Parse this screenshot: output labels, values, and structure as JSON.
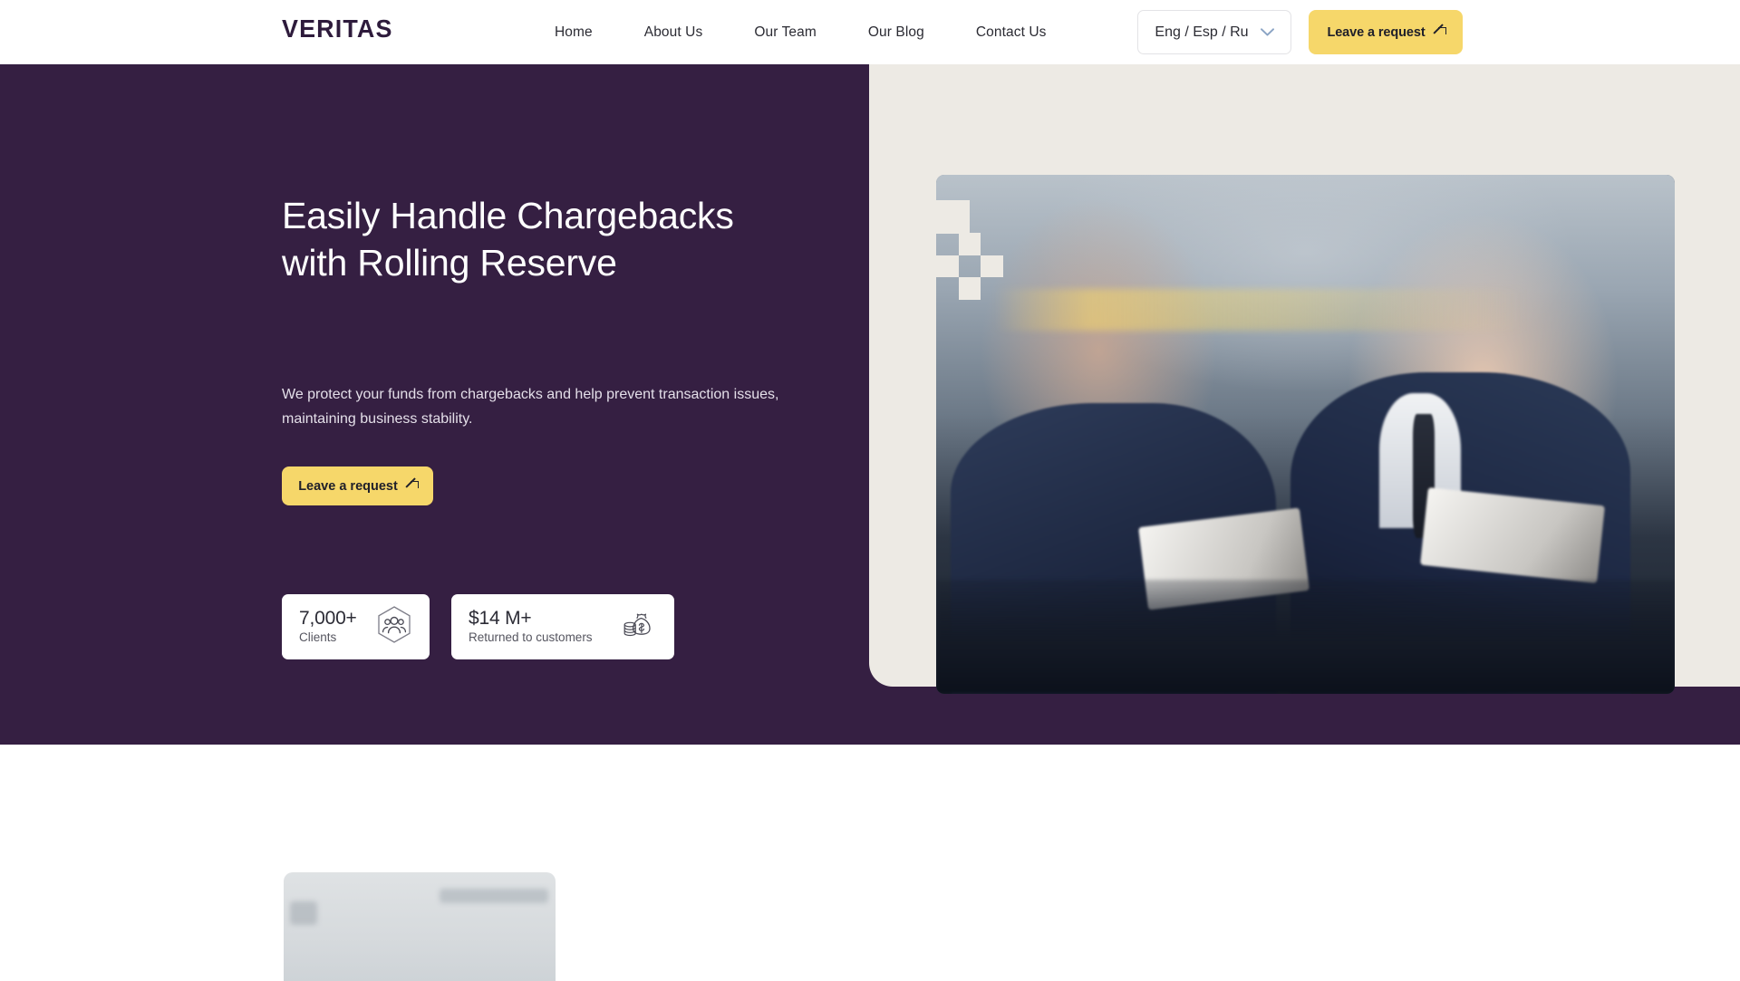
{
  "brand": {
    "logo_text": "VERITAS",
    "accent_yellow": "#F6D76A",
    "primary_purple": "#351F42",
    "panel_cream": "#EDEAE4",
    "logo_color": "#2E1B3C"
  },
  "header": {
    "nav": [
      {
        "label": "Home",
        "name": "nav-item-home"
      },
      {
        "label": "About Us",
        "name": "nav-item-about-us"
      },
      {
        "label": "Our Team",
        "name": "nav-item-our-team"
      },
      {
        "label": "Our Blog",
        "name": "nav-item-our-blog"
      },
      {
        "label": "Contact Us",
        "name": "nav-item-contact-us"
      }
    ],
    "language": {
      "selected": "Eng / Esp / Ru",
      "options": [
        "Eng",
        "Esp",
        "Ru"
      ],
      "chevron_icon": "chevron-down-icon"
    },
    "cta": {
      "label": "Leave a request",
      "icon": "arrow-up-right-icon"
    }
  },
  "hero": {
    "title_line_1": "Easily Handle Chargebacks",
    "title_line_2": "with Rolling Reserve",
    "subtitle": "We protect your funds from chargebacks and help prevent transaction issues, maintaining business stability.",
    "cta": {
      "label": "Leave a request",
      "icon": "arrow-up-right-icon"
    },
    "image": {
      "name": "hero-photo",
      "alt": "Two businessmen in suits meeting and reviewing documents in an office"
    },
    "decoration": {
      "name": "checkerboard-decoration",
      "color": "#EDEAE4"
    },
    "stats": [
      {
        "name": "stat-card-clients",
        "value": "7,000+",
        "label": "Clients",
        "icon": "people-group-hexagon-icon"
      },
      {
        "name": "stat-card-returned",
        "value": "$14 M+",
        "label": "Returned to customers",
        "icon": "money-bag-coins-icon"
      }
    ]
  },
  "below_fold": {
    "card": {
      "name": "content-card-placeholder"
    }
  }
}
